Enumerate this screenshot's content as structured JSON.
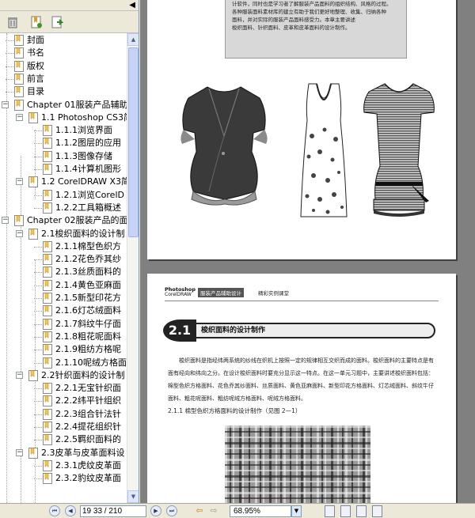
{
  "sidebar": {
    "collapse_glyph": "◀",
    "tools": [
      {
        "name": "delete-bookmark",
        "icon": "trash-icon"
      },
      {
        "name": "new-bookmark",
        "icon": "new-bookmark-icon"
      },
      {
        "name": "bookmark-properties",
        "icon": "properties-icon"
      }
    ],
    "bookmarks": [
      {
        "label": "封面",
        "level": 0,
        "expander": ""
      },
      {
        "label": "书名",
        "level": 0,
        "expander": ""
      },
      {
        "label": "版权",
        "level": 0,
        "expander": ""
      },
      {
        "label": "前言",
        "level": 0,
        "expander": ""
      },
      {
        "label": "目录",
        "level": 0,
        "expander": ""
      },
      {
        "label": "Chapter 01服装产品辅助",
        "level": 0,
        "expander": "−"
      },
      {
        "label": "1.1 Photoshop CS3简",
        "level": 1,
        "expander": "−"
      },
      {
        "label": "1.1.1浏览界面",
        "level": 2,
        "expander": ""
      },
      {
        "label": "1.1.2图层的应用",
        "level": 2,
        "expander": ""
      },
      {
        "label": "1.1.3图像存储",
        "level": 2,
        "expander": ""
      },
      {
        "label": "1.1.4计算机图形",
        "level": 2,
        "expander": ""
      },
      {
        "label": "1.2 CorelDRAW X3简",
        "level": 1,
        "expander": "−"
      },
      {
        "label": "1.2.1浏览CorelD",
        "level": 2,
        "expander": ""
      },
      {
        "label": "1.2.2工具箱概述",
        "level": 2,
        "expander": ""
      },
      {
        "label": "Chapter 02服装产品的面",
        "level": 0,
        "expander": "−"
      },
      {
        "label": "2.1梭织面料的设计制",
        "level": 1,
        "expander": "−"
      },
      {
        "label": "2.1.1棉型色织方",
        "level": 2,
        "expander": ""
      },
      {
        "label": "2.1.2花色乔其纱",
        "level": 2,
        "expander": ""
      },
      {
        "label": "2.1.3丝质面料的",
        "level": 2,
        "expander": ""
      },
      {
        "label": "2.1.4黄色亚麻面",
        "level": 2,
        "expander": ""
      },
      {
        "label": "2.1.5新型印花方",
        "level": 2,
        "expander": ""
      },
      {
        "label": "2.1.6灯芯绒面料",
        "level": 2,
        "expander": ""
      },
      {
        "label": "2.1.7斜纹牛仔面",
        "level": 2,
        "expander": ""
      },
      {
        "label": "2.1.8粗花呢面料",
        "level": 2,
        "expander": ""
      },
      {
        "label": "2.1.9粗纺方格呢",
        "level": 2,
        "expander": ""
      },
      {
        "label": "2.1.10呢绒方格面",
        "level": 2,
        "expander": ""
      },
      {
        "label": "2.2针织面料的设计制",
        "level": 1,
        "expander": "−"
      },
      {
        "label": "2.2.1无宝针织面",
        "level": 2,
        "expander": ""
      },
      {
        "label": "2.2.2纬平针组织",
        "level": 2,
        "expander": ""
      },
      {
        "label": "2.2.3组合针法针",
        "level": 2,
        "expander": ""
      },
      {
        "label": "2.2.4提花组织针",
        "level": 2,
        "expander": ""
      },
      {
        "label": "2.2.5羁织面料的",
        "level": 2,
        "expander": ""
      },
      {
        "label": "2.3皮革与皮革面料设",
        "level": 1,
        "expander": "−"
      },
      {
        "label": "2.3.1虎纹皮革面",
        "level": 2,
        "expander": ""
      },
      {
        "label": "2.3.2豹纹皮革面",
        "level": 2,
        "expander": ""
      }
    ]
  },
  "page1": {
    "text_lines": [
      "计软件，同时也是学习者了解服装产品面料的组织结构、风格的过程。",
      "各种服装面料素材库的建立有助于我们更好地整理、收集、归纳各种",
      "面料，并对实际的服装产品面料感受力。本章主要讲述",
      "梭织面料、针织面料、皮革和皮革面料的设计制作。"
    ]
  },
  "page2": {
    "brand_line1": "Photoshop",
    "brand_line2": "CorelDRAW",
    "tag": "服装产品辅助设计",
    "tag_suffix": "精彩实例课堂",
    "section_number": "2.1",
    "section_title": "梭织面料的设计制作",
    "body": "梭织面料是指经纬两系统的纱线在织机上按照一定的规律相互交织而成的面料。梭织面料的主要特点是有面有经向和纬向之分。在设计梭织面料时要充分显示这一特点。在这一单元习题中，主要讲述梭织面料包括：棉型色织方格面料、花色乔其纱面料、丝质面料、黄色亚麻面料、新型印花方格面料、灯芯绒面料、斜纹牛仔面料、粗花呢面料、粗纺呢绒方格面料、呢绒方格面料。",
    "subhead": "2.1.1   棉型色织方格面料的设计制作（见图 2—1）"
  },
  "statusbar": {
    "page_current": "19",
    "page_index": "33 / 210",
    "zoom": "68.95%",
    "dropdown_glyph": "▼"
  },
  "colors": {
    "chrome": "#ece9d8",
    "doc_bg": "#808080",
    "bookmark_icon": "#f2c84b",
    "selection_border": "#7f9db9"
  }
}
